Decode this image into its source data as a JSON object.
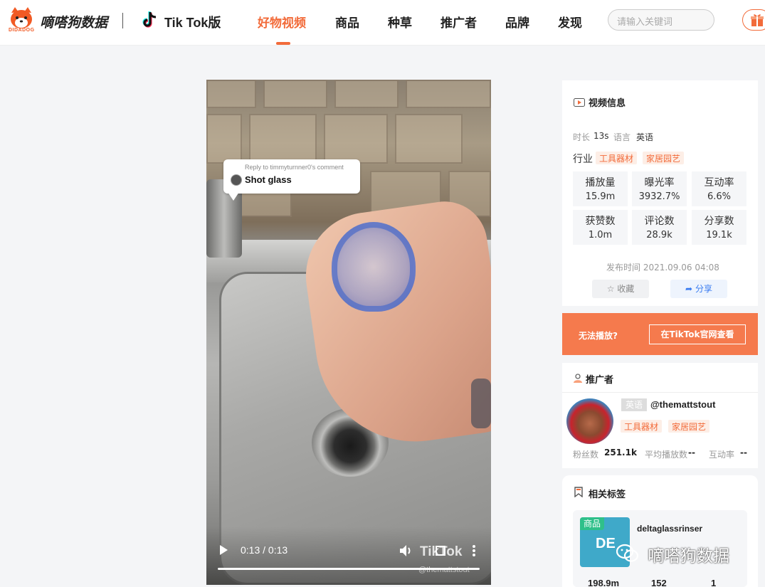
{
  "header": {
    "logo_sub": "DIDADOG",
    "brand": "嘀嗒狗数据",
    "platform": "Tik Tok版",
    "nav": [
      "好物视频",
      "商品",
      "种草",
      "推广者",
      "品牌",
      "发现"
    ],
    "active_nav": "好物视频",
    "search_placeholder": "请输入关键词",
    "colors": {
      "accent": "#f26b3a"
    }
  },
  "video": {
    "comment_reply": "Reply to timmyturnner0's comment",
    "comment_text": "Shot glass",
    "time": "0:13 / 0:13",
    "watermark": "TikTok",
    "watermark_handle": "@themattstout",
    "progress": 1.0
  },
  "video_info": {
    "title": "视频信息",
    "duration_label": "时长",
    "duration": "13s",
    "language_label": "语言",
    "language": "英语",
    "industry_label": "行业",
    "industry_tags": [
      "工具器材",
      "家居园艺"
    ],
    "stats": [
      {
        "label": "播放量",
        "value": "15.9m"
      },
      {
        "label": "曝光率",
        "value": "3932.7%"
      },
      {
        "label": "互动率",
        "value": "6.6%"
      },
      {
        "label": "获赞数",
        "value": "1.0m"
      },
      {
        "label": "评论数",
        "value": "28.9k"
      },
      {
        "label": "分享数",
        "value": "19.1k"
      }
    ],
    "publish_time": "发布时间 2021.09.06 04:08",
    "fav_label": "收藏",
    "share_label": "分享"
  },
  "cta": {
    "text": "无法播放?",
    "button": "在TikTok官网查看"
  },
  "promoter": {
    "title": "推广者",
    "lang_badge": "英语",
    "handle": "@themattstout",
    "tags": [
      "工具器材",
      "家居园艺"
    ],
    "fans_label": "粉丝数",
    "fans": "251.1k",
    "avg_play_label": "平均播放数",
    "avg_play": "--",
    "interaction_label": "互动率",
    "interaction": "--"
  },
  "related_tags": {
    "title": "相关标签",
    "badge": "商品",
    "thumb_text": "DE",
    "name": "deltaglassrinser",
    "numbers": [
      "198.9m",
      "152",
      "1"
    ]
  },
  "wechat_watermark": "嘀嗒狗数据"
}
